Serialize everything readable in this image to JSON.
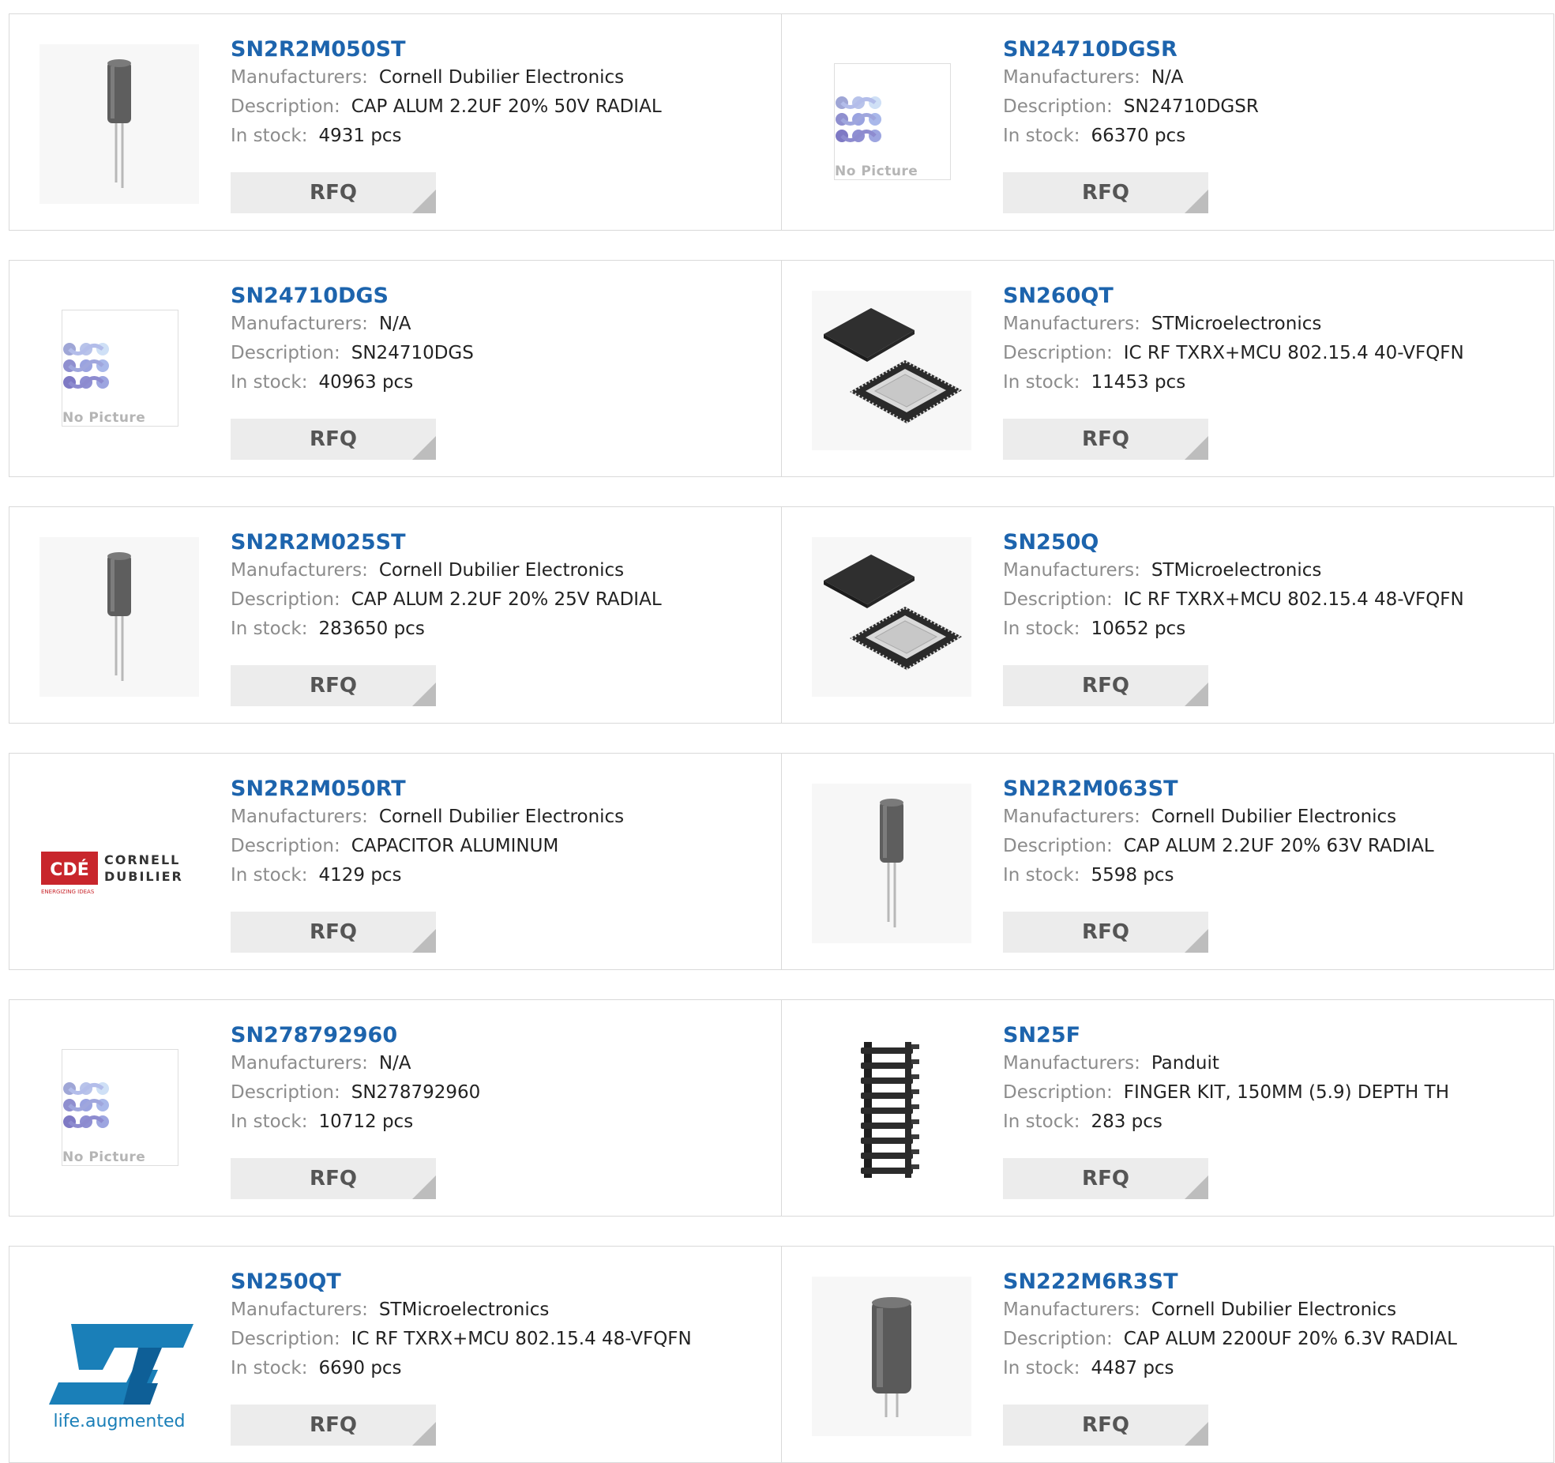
{
  "labels": {
    "manufacturers": "Manufacturers:",
    "description": "Description:",
    "stock": "In stock:",
    "rfq": "RFQ",
    "no_picture": "No Picture"
  },
  "products": [
    {
      "part": "SN2R2M050ST",
      "manufacturer": "Cornell Dubilier Electronics",
      "description": "CAP ALUM 2.2UF 20% 50V RADIAL",
      "stock": "4931 pcs",
      "image": "capacitor-small"
    },
    {
      "part": "SN24710DGSR",
      "manufacturer": "N/A",
      "description": "SN24710DGSR",
      "stock": "66370 pcs",
      "image": "no-picture"
    },
    {
      "part": "SN24710DGS",
      "manufacturer": "N/A",
      "description": "SN24710DGS",
      "stock": "40963 pcs",
      "image": "no-picture"
    },
    {
      "part": "SN260QT",
      "manufacturer": "STMicroelectronics",
      "description": "IC RF TXRX+MCU 802.15.4 40-VFQFN",
      "stock": "11453 pcs",
      "image": "qfn-chip"
    },
    {
      "part": "SN2R2M025ST",
      "manufacturer": "Cornell Dubilier Electronics",
      "description": "CAP ALUM 2.2UF 20% 25V RADIAL",
      "stock": "283650 pcs",
      "image": "capacitor-small"
    },
    {
      "part": "SN250Q",
      "manufacturer": "STMicroelectronics",
      "description": "IC RF TXRX+MCU 802.15.4 48-VFQFN",
      "stock": "10652 pcs",
      "image": "qfn-chip"
    },
    {
      "part": "SN2R2M050RT",
      "manufacturer": "Cornell Dubilier Electronics",
      "description": "CAPACITOR ALUMINUM",
      "stock": "4129 pcs",
      "image": "cde-logo",
      "logo_text": [
        "CDÉ",
        "CORNELL",
        "DUBILIER",
        "ENERGIZING IDEAS"
      ]
    },
    {
      "part": "SN2R2M063ST",
      "manufacturer": "Cornell Dubilier Electronics",
      "description": "CAP ALUM 2.2UF 20% 63V RADIAL",
      "stock": "5598 pcs",
      "image": "capacitor-small"
    },
    {
      "part": "SN278792960",
      "manufacturer": "N/A",
      "description": "SN278792960",
      "stock": "10712 pcs",
      "image": "no-picture"
    },
    {
      "part": "SN25F",
      "manufacturer": "Panduit",
      "description": "FINGER KIT, 150MM (5.9) DEPTH TH",
      "stock": "283 pcs",
      "image": "finger-kit"
    },
    {
      "part": "SN250QT",
      "manufacturer": "STMicroelectronics",
      "description": "IC RF TXRX+MCU 802.15.4 48-VFQFN",
      "stock": "6690 pcs",
      "image": "st-logo",
      "logo_text": [
        "life.augmented"
      ]
    },
    {
      "part": "SN222M6R3ST",
      "manufacturer": "Cornell Dubilier Electronics",
      "description": "CAP ALUM 2200UF 20% 6.3V RADIAL",
      "stock": "4487 pcs",
      "image": "capacitor-large"
    }
  ],
  "colors": {
    "part_link": "#1d64ad",
    "label": "#8c8c8c",
    "value": "#222222",
    "rfq_bg": "#ececec",
    "border": "#d9d9d9"
  }
}
